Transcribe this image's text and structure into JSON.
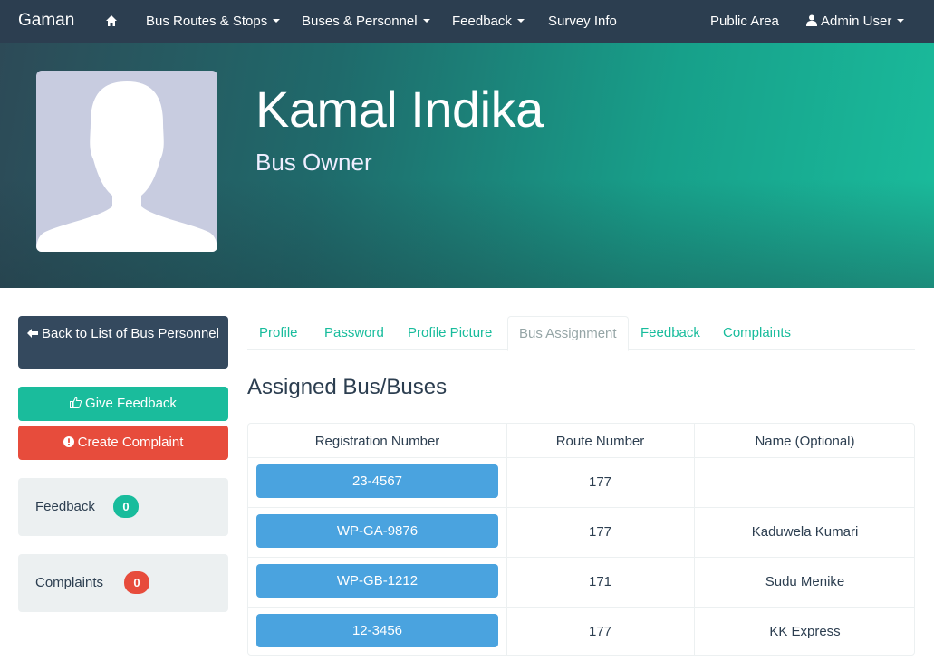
{
  "navbar": {
    "brand": "Gaman",
    "home_icon": "home-icon",
    "items": [
      "Bus Routes & Stops",
      "Buses & Personnel",
      "Feedback",
      "Survey Info"
    ],
    "public_area": "Public Area",
    "user": "Admin User",
    "user_icon": "user-icon",
    "bg_color": "#2c3e50"
  },
  "profile": {
    "name": "Kamal Indika",
    "role": "Bus Owner"
  },
  "sidebar": {
    "back_button": "Back to List of Bus Personnel",
    "back_icon": "arrow-left-icon",
    "give_feedback": "Give Feedback",
    "feedback_icon": "thumbs-up-icon",
    "create_complaint": "Create Complaint",
    "complaint_icon": "exclamation-circle-icon",
    "feedback_label": "Feedback",
    "feedback_count": "0",
    "complaints_label": "Complaints",
    "complaints_count": "0",
    "colors": {
      "primary": "#34495e",
      "success": "#1abc9c",
      "danger": "#e74c3c",
      "well": "#ecf0f1"
    }
  },
  "tabs": [
    {
      "label": "Profile"
    },
    {
      "label": "Password"
    },
    {
      "label": "Profile Picture"
    },
    {
      "label": "Bus Assignment",
      "active": true
    },
    {
      "label": "Feedback"
    },
    {
      "label": "Complaints"
    }
  ],
  "assigned": {
    "title": "Assigned Bus/Buses",
    "columns": [
      "Registration Number",
      "Route Number",
      "Name (Optional)"
    ],
    "rows": [
      {
        "registration": "23-4567",
        "route": "177",
        "name": ""
      },
      {
        "registration": "WP-GA-9876",
        "route": "177",
        "name": "Kaduwela Kumari"
      },
      {
        "registration": "WP-GB-1212",
        "route": "171",
        "name": "Sudu Menike"
      },
      {
        "registration": "12-3456",
        "route": "177",
        "name": "KK Express"
      }
    ]
  }
}
